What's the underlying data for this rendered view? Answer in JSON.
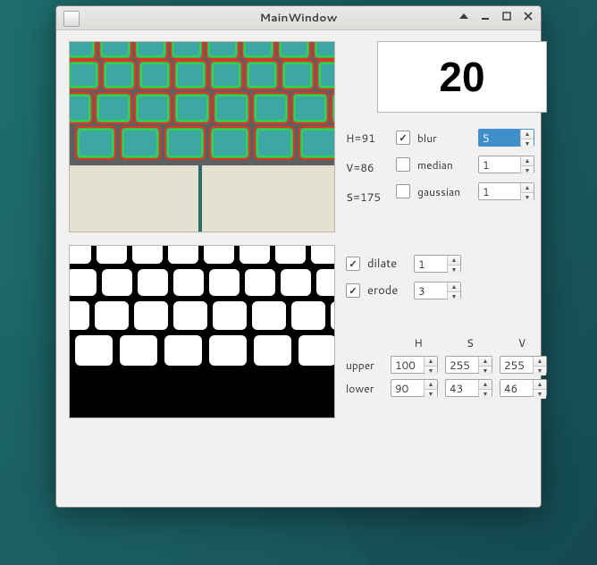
{
  "window": {
    "title": "MainWindow"
  },
  "count_display": "20",
  "hsv_readout": {
    "h": "H=91",
    "v": "V=86",
    "s": "S=175"
  },
  "filters": {
    "blur": {
      "label": "blur",
      "checked": true,
      "value": "5"
    },
    "median": {
      "label": "median",
      "checked": false,
      "value": "1"
    },
    "gaussian": {
      "label": "gaussian",
      "checked": false,
      "value": "1"
    }
  },
  "morph": {
    "dilate": {
      "label": "dilate",
      "checked": true,
      "value": "1"
    },
    "erode": {
      "label": "erode",
      "checked": true,
      "value": "3"
    }
  },
  "range": {
    "headers": {
      "h": "H",
      "s": "S",
      "v": "V"
    },
    "upper": {
      "label": "upper",
      "h": "100",
      "s": "255",
      "v": "255"
    },
    "lower": {
      "label": "lower",
      "h": "90",
      "s": "43",
      "v": "46"
    }
  }
}
